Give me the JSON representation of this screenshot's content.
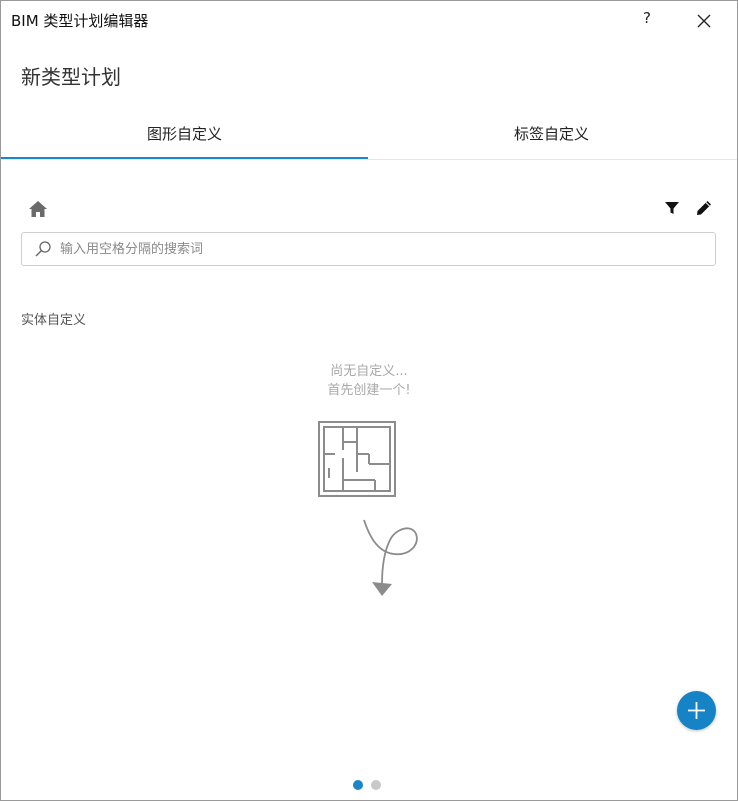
{
  "window": {
    "title": "BIM 类型计划编辑器",
    "help_label": "?"
  },
  "page": {
    "title": "新类型计划"
  },
  "tabs": [
    {
      "label": "图形自定义",
      "active": true
    },
    {
      "label": "标签自定义",
      "active": false
    }
  ],
  "toolbar": {
    "home_icon": "home-icon",
    "filter_icon": "filter-icon",
    "edit_icon": "pencil-icon"
  },
  "search": {
    "placeholder": "输入用空格分隔的搜索词",
    "value": ""
  },
  "section": {
    "label": "实体自定义"
  },
  "empty_state": {
    "line1": "尚无自定义...",
    "line2": "首先创建一个!"
  },
  "pagination": {
    "pages": 2,
    "current": 1
  },
  "colors": {
    "accent": "#1a86c8",
    "fab": "#1583c6"
  }
}
